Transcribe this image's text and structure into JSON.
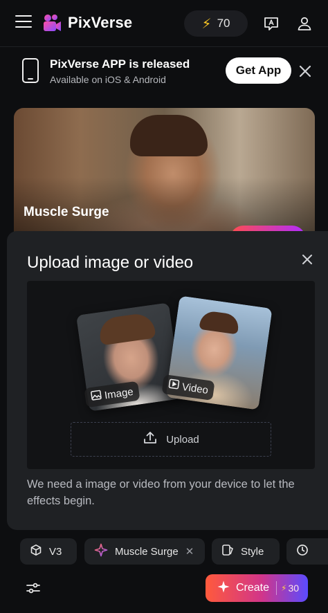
{
  "header": {
    "logo_text": "PixVerse",
    "credits": "70",
    "icons": [
      "menu-icon",
      "lightning-icon",
      "feedback-icon",
      "user-icon"
    ]
  },
  "app_banner": {
    "title": "PixVerse APP is released",
    "subtitle": "Available on iOS & Android",
    "button": "Get App"
  },
  "hero": {
    "title": "Muscle Surge"
  },
  "modal": {
    "title": "Upload image or video",
    "chip_image": "Image",
    "chip_video": "Video",
    "upload_label": "Upload",
    "description": "We need a image or video from your device to let the effects begin."
  },
  "toolbar": {
    "model_label": "V3",
    "effect_label": "Muscle Surge",
    "style_label": "Style",
    "create_label": "Create",
    "create_cost": "30"
  },
  "colors": {
    "background": "#0d0e10",
    "panel": "#1f2124",
    "accent_bolt": "#f6c324",
    "create_gradient": [
      "#ff5a3c",
      "#d1358a",
      "#5b4bff"
    ]
  }
}
